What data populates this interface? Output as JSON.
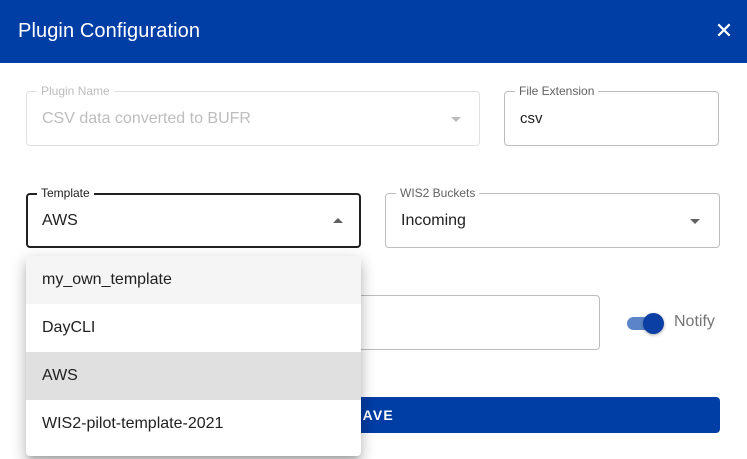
{
  "dialog": {
    "title": "Plugin Configuration",
    "close_symbol": "✕"
  },
  "form": {
    "plugin_name": {
      "label": "Plugin Name",
      "value": "CSV data converted to BUFR",
      "disabled": true
    },
    "file_extension": {
      "label": "File Extension",
      "value": "csv"
    },
    "template": {
      "label": "Template",
      "value": "AWS"
    },
    "wis2_buckets": {
      "label": "WIS2 Buckets",
      "value": "Incoming"
    },
    "notify": {
      "label": "Notify",
      "checked": true
    },
    "save_label": "SAVE"
  },
  "template_menu": {
    "items": [
      {
        "label": "my_own_template",
        "state": "hover"
      },
      {
        "label": "DayCLI",
        "state": "normal"
      },
      {
        "label": "AWS",
        "state": "selected"
      },
      {
        "label": "WIS2-pilot-template-2021",
        "state": "normal"
      }
    ]
  },
  "colors": {
    "primary": "#003da5",
    "toggle_thumb": "#0c3fa3",
    "toggle_track": "#5b85c8"
  },
  "icons": {
    "close": "close-icon",
    "dropdown": "arrow-drop-down-icon",
    "dropup": "arrow-drop-up-icon"
  }
}
